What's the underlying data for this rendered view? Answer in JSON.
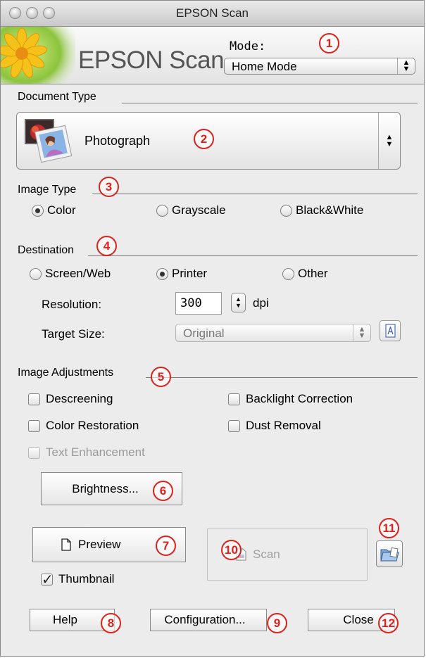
{
  "window": {
    "title": "EPSON Scan"
  },
  "header": {
    "brand": "EPSON Scan",
    "mode_label": "Mode:",
    "mode_value": "Home Mode"
  },
  "document_type": {
    "title": "Document Type",
    "value": "Photograph"
  },
  "image_type": {
    "title": "Image Type",
    "options": [
      "Color",
      "Grayscale",
      "Black&White"
    ],
    "selected": "Color"
  },
  "destination": {
    "title": "Destination",
    "options": [
      "Screen/Web",
      "Printer",
      "Other"
    ],
    "selected": "Printer",
    "resolution_label": "Resolution:",
    "resolution_value": "300",
    "resolution_unit": "dpi",
    "target_size_label": "Target Size:",
    "target_size_value": "Original"
  },
  "image_adjustments": {
    "title": "Image Adjustments",
    "descreening": "Descreening",
    "backlight_correction": "Backlight Correction",
    "color_restoration": "Color Restoration",
    "dust_removal": "Dust Removal",
    "text_enhancement": "Text Enhancement",
    "brightness_button": "Brightness..."
  },
  "actions": {
    "preview": "Preview",
    "thumbnail": "Thumbnail",
    "scan": "Scan",
    "help": "Help",
    "configuration": "Configuration...",
    "close": "Close"
  },
  "markers": [
    "1",
    "2",
    "3",
    "4",
    "5",
    "6",
    "7",
    "8",
    "9",
    "10",
    "11",
    "12"
  ],
  "colors": {
    "marker": "#e0201a",
    "window_bg": "#ececec"
  }
}
